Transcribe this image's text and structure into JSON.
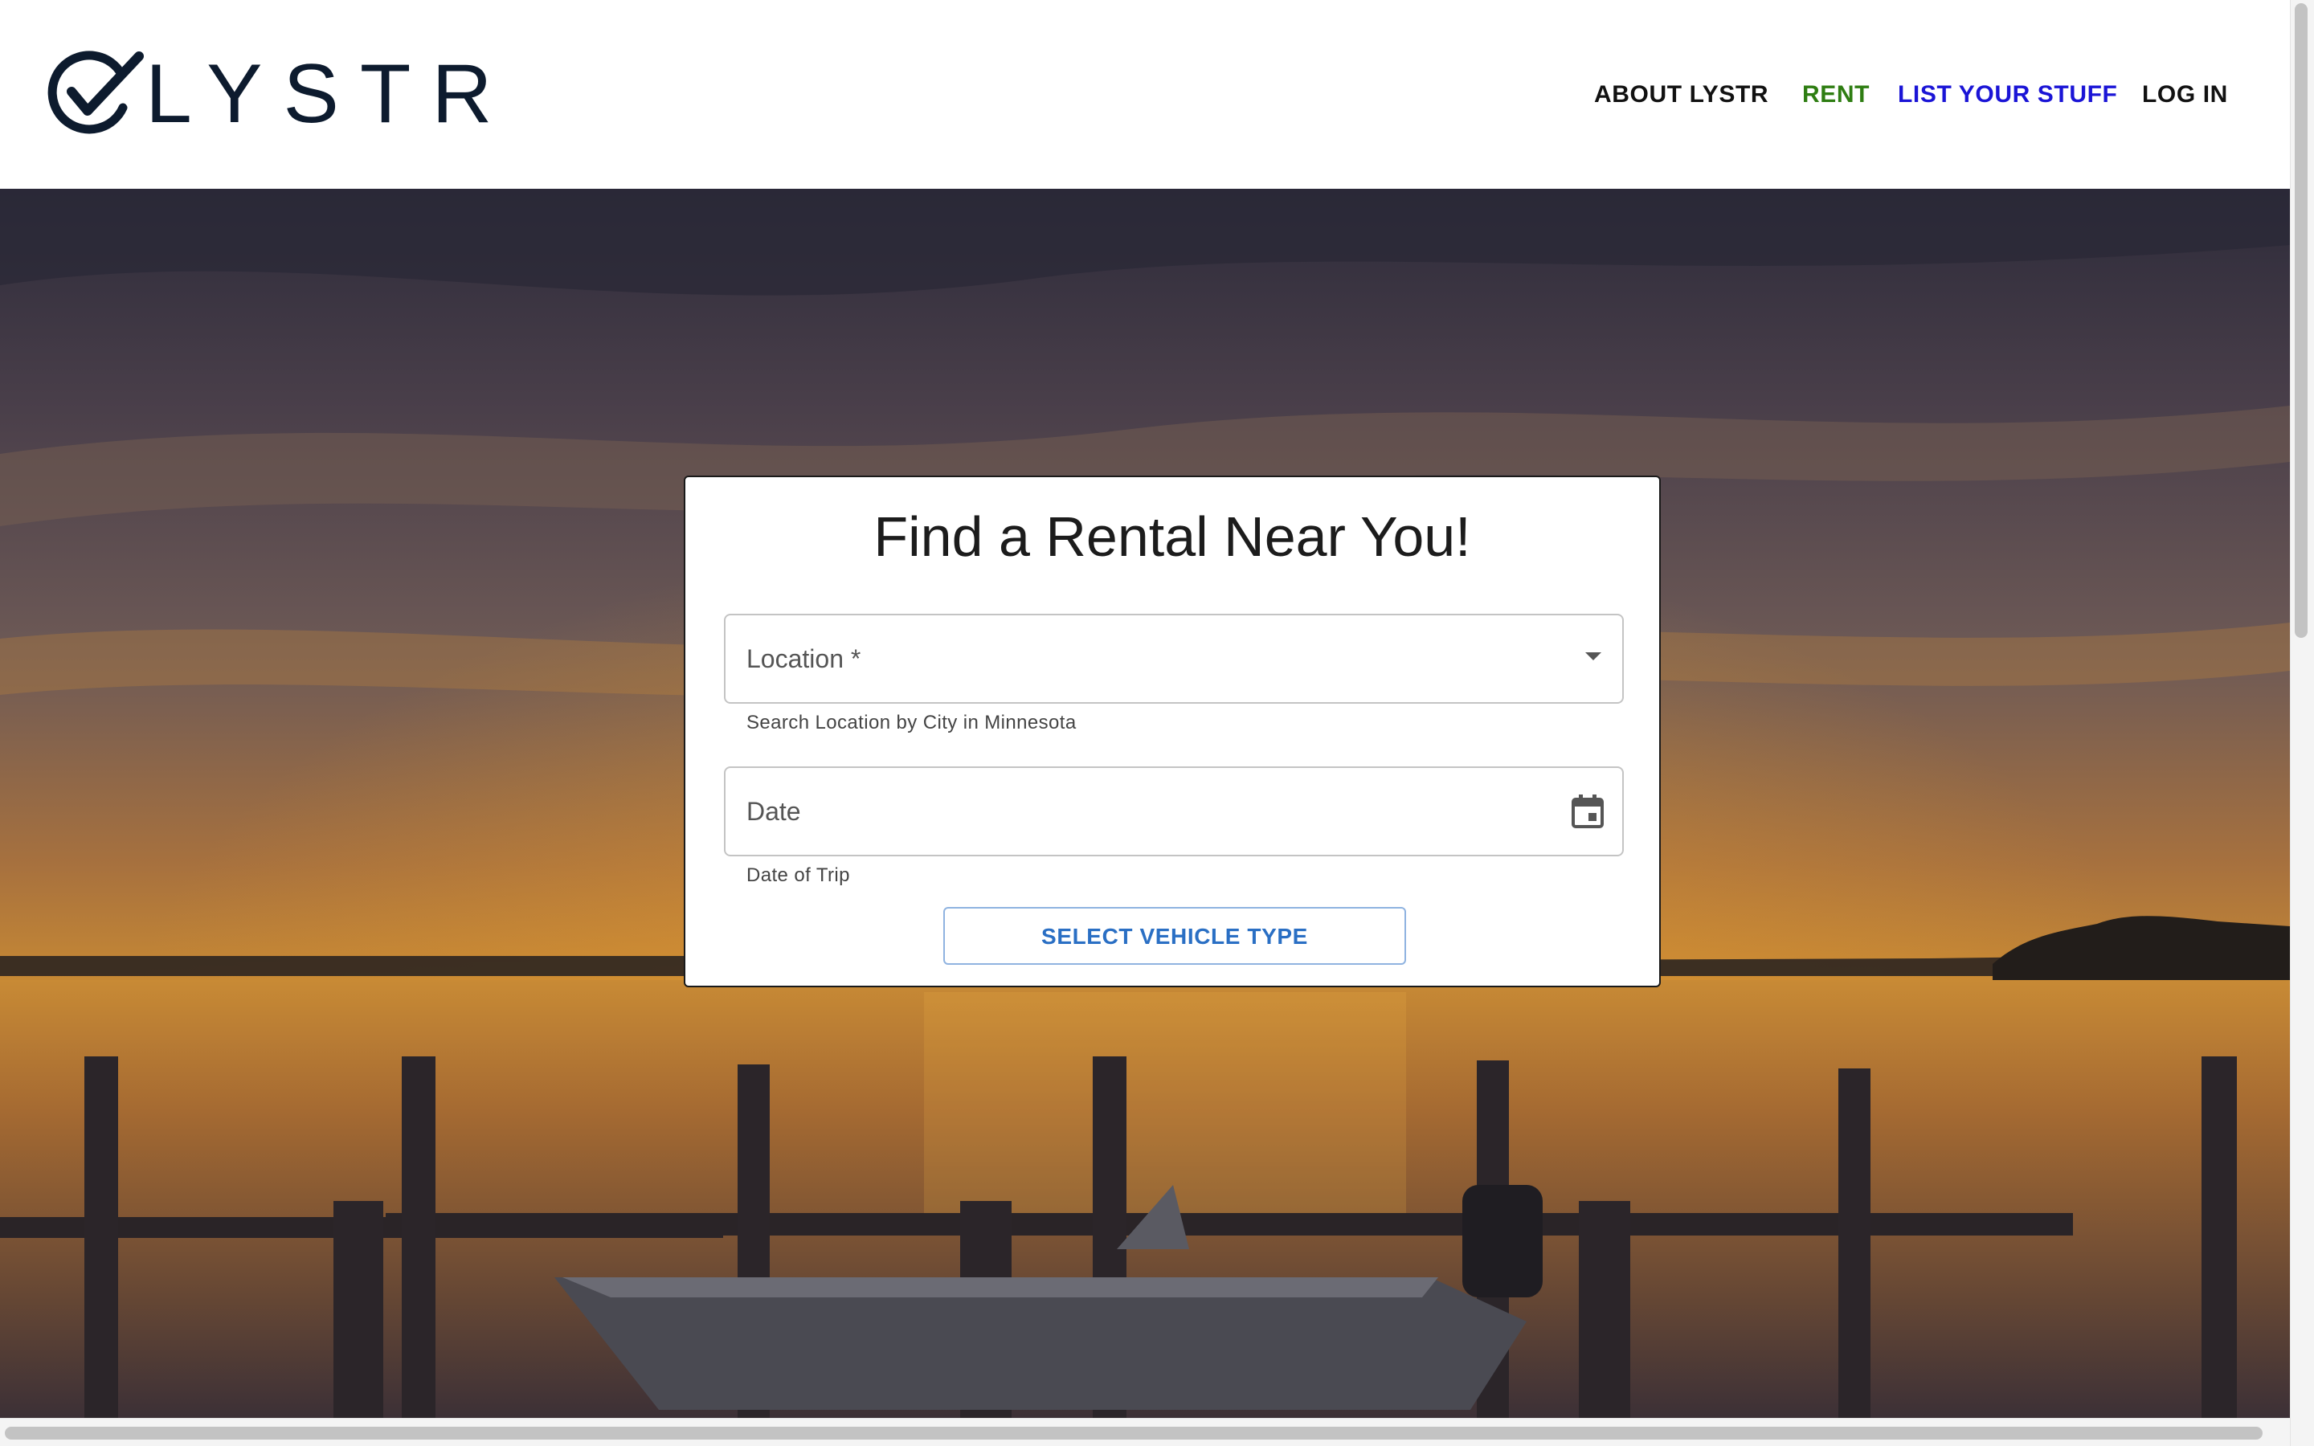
{
  "header": {
    "brand": "LYSTR",
    "nav": {
      "about": "ABOUT LYSTR",
      "rent": "RENT",
      "list": "LIST YOUR STUFF",
      "login": "LOG IN"
    },
    "colors": {
      "brand": "#0d1b2e",
      "rent": "#2e7d12",
      "list": "#1a14d6"
    }
  },
  "search_card": {
    "title": "Find a Rental Near You!",
    "location": {
      "label": "Location *",
      "helper": "Search Location by City in Minnesota",
      "icon": "chevron-down-icon"
    },
    "date": {
      "label": "Date",
      "helper": "Date of Trip",
      "icon": "calendar-icon"
    },
    "vehicle_button": "SELECT VEHICLE TYPE"
  },
  "hero": {
    "image": "sunset-lake-dock-boat"
  }
}
